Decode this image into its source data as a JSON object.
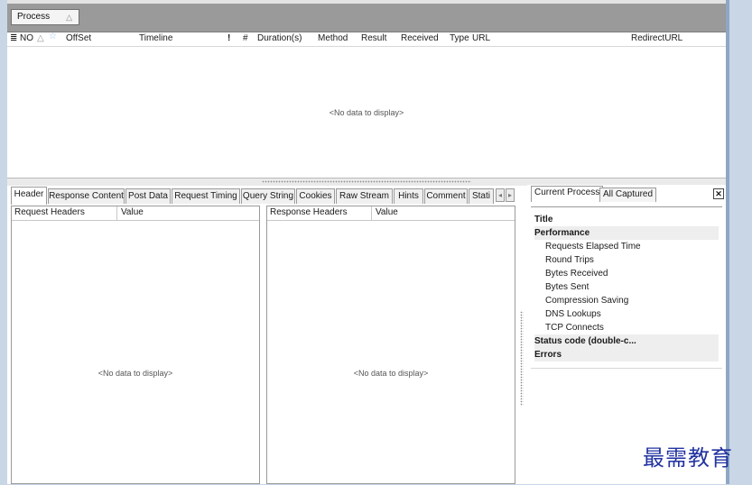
{
  "group_by": {
    "label": "Process",
    "sort_glyph": "△"
  },
  "columns": {
    "menu_glyph": "≣",
    "no": "NO",
    "no_sort": "△",
    "offset": "OffSet",
    "timeline": "Timeline",
    "flag": "!",
    "hash": "#",
    "duration": "Duration(s)",
    "method": "Method",
    "result": "Result",
    "received": "Received",
    "type": "Type",
    "url": "URL",
    "redirect": "RedirectURL"
  },
  "upper_empty": "<No data to display>",
  "tabs": [
    "Header",
    "Response Content",
    "Post Data",
    "Request Timing",
    "Query String",
    "Cookies",
    "Raw Stream",
    "Hints",
    "Comment",
    "Stati"
  ],
  "tab_scroll": {
    "left": "◂",
    "right": "▸"
  },
  "request_pane": {
    "col1": "Request Headers",
    "col2": "Value",
    "empty": "<No data to display>"
  },
  "response_pane": {
    "col1": "Response Headers",
    "col2": "Value",
    "empty": "<No data to display>"
  },
  "right_panel": {
    "tabs": [
      "Current Process",
      "All Captured"
    ],
    "close": "✕",
    "rows": [
      "Title",
      "Performance",
      "Requests Elapsed Time",
      "Round Trips",
      "Bytes Received",
      "Bytes Sent",
      "Compression Saving",
      "DNS Lookups",
      "TCP Connects",
      "Status code (double-c...",
      "Errors"
    ]
  },
  "watermark": "最需教育"
}
